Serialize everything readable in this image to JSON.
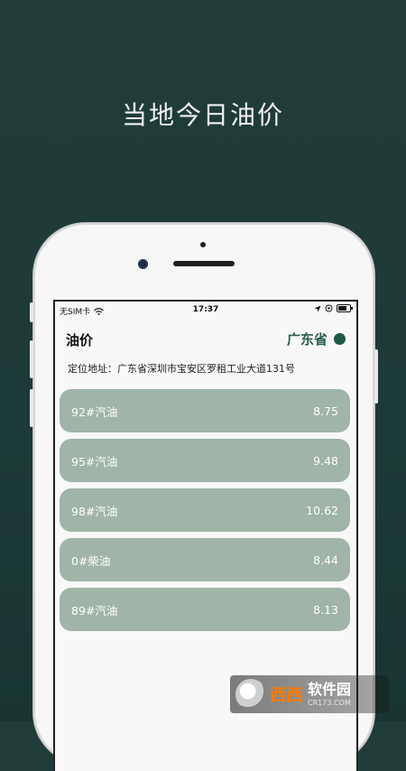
{
  "headline": "当地今日油价",
  "status_bar": {
    "carrier": "无SIM卡",
    "time": "17:37"
  },
  "nav": {
    "title": "油价",
    "province": "广东省"
  },
  "location": {
    "text": "定位地址：广东省深圳市宝安区罗租工业大道131号"
  },
  "prices": [
    {
      "name": "92#汽油",
      "price": "8.75"
    },
    {
      "name": "95#汽油",
      "price": "9.48"
    },
    {
      "name": "98#汽油",
      "price": "10.62"
    },
    {
      "name": "0#柴油",
      "price": "8.44"
    },
    {
      "name": "89#汽油",
      "price": "8.13"
    }
  ],
  "watermark": {
    "brand": "西西",
    "title": "软件园",
    "url": "CR173.COM"
  },
  "colors": {
    "background": "#1c3a37",
    "card": "#a0b4a8",
    "accent": "#1e5a45"
  }
}
